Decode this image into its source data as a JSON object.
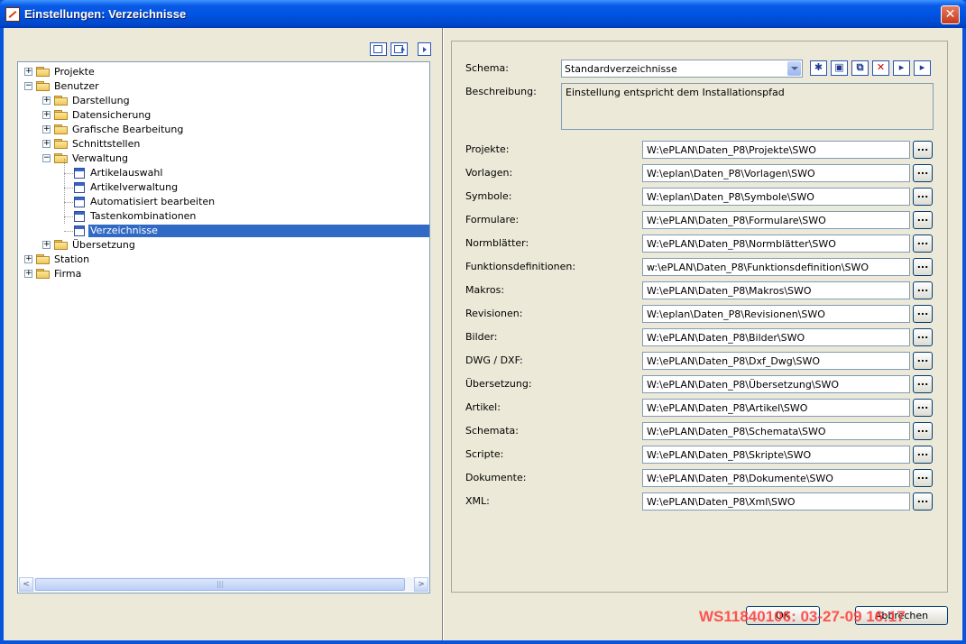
{
  "window": {
    "title": "Einstellungen: Verzeichnisse",
    "close_symbol": "✕"
  },
  "tree": {
    "items": [
      {
        "label": "Projekte",
        "level": 0,
        "expander": "+",
        "icon": "folder-icon"
      },
      {
        "label": "Benutzer",
        "level": 0,
        "expander": "−",
        "icon": "folder-icon"
      },
      {
        "label": "Darstellung",
        "level": 1,
        "expander": "+",
        "icon": "folder-icon"
      },
      {
        "label": "Datensicherung",
        "level": 1,
        "expander": "+",
        "icon": "folder-icon"
      },
      {
        "label": "Grafische Bearbeitung",
        "level": 1,
        "expander": "+",
        "icon": "folder-icon"
      },
      {
        "label": "Schnittstellen",
        "level": 1,
        "expander": "+",
        "icon": "folder-icon"
      },
      {
        "label": "Verwaltung",
        "level": 1,
        "expander": "−",
        "icon": "folder-icon"
      },
      {
        "label": "Artikelauswahl",
        "level": 2,
        "expander": "",
        "icon": "settings-page-icon"
      },
      {
        "label": "Artikelverwaltung",
        "level": 2,
        "expander": "",
        "icon": "settings-page-icon"
      },
      {
        "label": "Automatisiert bearbeiten",
        "level": 2,
        "expander": "",
        "icon": "settings-page-icon"
      },
      {
        "label": "Tastenkombinationen",
        "level": 2,
        "expander": "",
        "icon": "settings-page-icon"
      },
      {
        "label": "Verzeichnisse",
        "level": 2,
        "expander": "",
        "icon": "settings-page-icon",
        "selected": true
      },
      {
        "label": "Übersetzung",
        "level": 1,
        "expander": "+",
        "icon": "folder-icon"
      },
      {
        "label": "Station",
        "level": 0,
        "expander": "+",
        "icon": "folder-icon"
      },
      {
        "label": "Firma",
        "level": 0,
        "expander": "+",
        "icon": "folder-icon"
      }
    ],
    "scroll_left": "<",
    "scroll_right": ">",
    "scroll_grip": "|||"
  },
  "schema": {
    "label": "Schema:",
    "value": "Standardverzeichnisse",
    "description_label": "Beschreibung:",
    "description": "Einstellung entspricht dem Installationspfad"
  },
  "directories": [
    {
      "label": "Projekte:",
      "path": "W:\\ePLAN\\Daten_P8\\Projekte\\SWO"
    },
    {
      "label": "Vorlagen:",
      "path": "W:\\eplan\\Daten_P8\\Vorlagen\\SWO"
    },
    {
      "label": "Symbole:",
      "path": "W:\\eplan\\Daten_P8\\Symbole\\SWO"
    },
    {
      "label": "Formulare:",
      "path": "W:\\ePLAN\\Daten_P8\\Formulare\\SWO"
    },
    {
      "label": "Normblätter:",
      "path": "W:\\ePLAN\\Daten_P8\\Normblätter\\SWO"
    },
    {
      "label": "Funktionsdefinitionen:",
      "path": "w:\\ePLAN\\Daten_P8\\Funktionsdefinition\\SWO"
    },
    {
      "label": "Makros:",
      "path": "W:\\ePLAN\\Daten_P8\\Makros\\SWO"
    },
    {
      "label": "Revisionen:",
      "path": "W:\\eplan\\Daten_P8\\Revisionen\\SWO"
    },
    {
      "label": "Bilder:",
      "path": "W:\\ePLAN\\Daten_P8\\Bilder\\SWO"
    },
    {
      "label": "DWG / DXF:",
      "path": "W:\\ePLAN\\Daten_P8\\Dxf_Dwg\\SWO"
    },
    {
      "label": "Übersetzung:",
      "path": "W:\\ePLAN\\Daten_P8\\Übersetzung\\SWO"
    },
    {
      "label": "Artikel:",
      "path": "W:\\ePLAN\\Daten_P8\\Artikel\\SWO"
    },
    {
      "label": "Schemata:",
      "path": "W:\\ePLAN\\Daten_P8\\Schemata\\SWO"
    },
    {
      "label": "Scripte:",
      "path": "W:\\ePLAN\\Daten_P8\\Skripte\\SWO"
    },
    {
      "label": "Dokumente:",
      "path": "W:\\ePLAN\\Daten_P8\\Dokumente\\SWO"
    },
    {
      "label": "XML:",
      "path": "W:\\ePLAN\\Daten_P8\\Xml\\SWO"
    }
  ],
  "browse_label": "...",
  "toolbar": {
    "new_symbol": "✱",
    "save_symbol": "▣",
    "copy_symbol": "⧉",
    "delete_symbol": "✕",
    "import_symbol": "▸",
    "export_symbol": "▸"
  },
  "buttons": {
    "ok": "OK",
    "cancel": "Abbrechen"
  },
  "watermark": "WS11840106: 03-27-09 16:17"
}
